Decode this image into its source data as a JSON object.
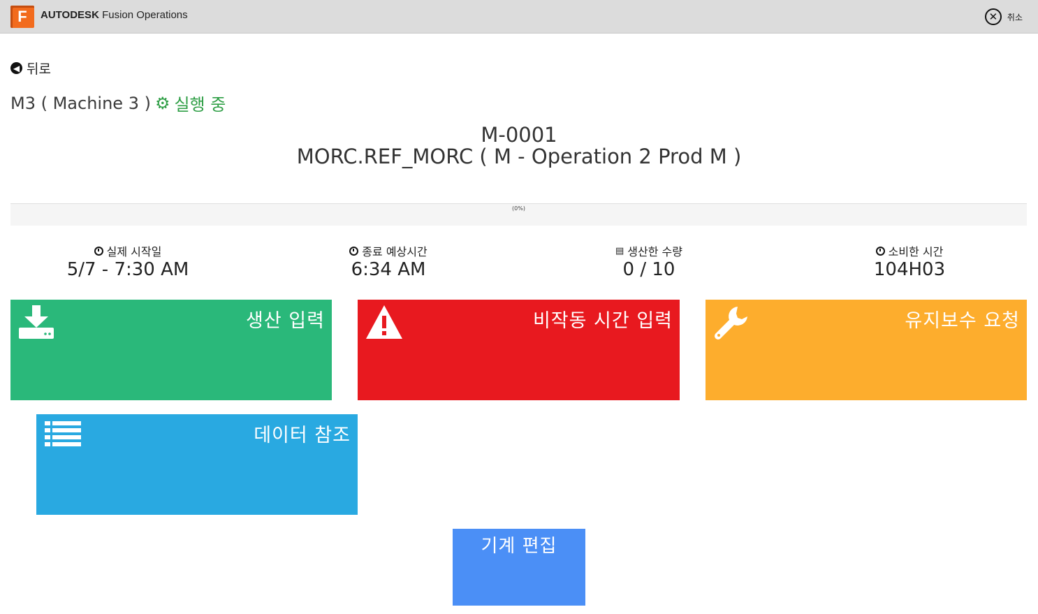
{
  "header": {
    "logo_letter": "F",
    "brand_bold": "AUTODESK",
    "brand_rest": "Fusion Operations",
    "cancel_label": "취소"
  },
  "nav": {
    "back_label": "뒤로"
  },
  "machine": {
    "name": "M3 ( Machine 3 )",
    "status": "실행 중"
  },
  "order": {
    "id": "M-0001",
    "description": "MORC.REF_MORC ( M - Operation 2 Prod M )"
  },
  "progress": {
    "value": 0,
    "label": "(0%)"
  },
  "stats": [
    {
      "label": "실제 시작일",
      "value": "5/7 - 7:30 AM",
      "icon": "clock-icon"
    },
    {
      "label": "종료 예상시간",
      "value": "6:34 AM",
      "icon": "clock-icon"
    },
    {
      "label": "생산한 수량",
      "value": "0 / 10",
      "icon": "stack-icon"
    },
    {
      "label": "소비한 시간",
      "value": "104H03",
      "icon": "clock-icon"
    }
  ],
  "tiles": {
    "production": {
      "label": "생산 입력",
      "icon": "download-icon",
      "color": "#2ab87a"
    },
    "downtime": {
      "label": "비작동 시간 입력",
      "icon": "warning-icon",
      "color": "#e8191f"
    },
    "maintenance": {
      "label": "유지보수 요청",
      "icon": "wrench-icon",
      "color": "#fdad2d"
    },
    "data": {
      "label": "데이터 참조",
      "icon": "list-icon",
      "color": "#29a9e1"
    },
    "edit": {
      "label": "기계 편집",
      "color": "#4b8ff6"
    }
  }
}
